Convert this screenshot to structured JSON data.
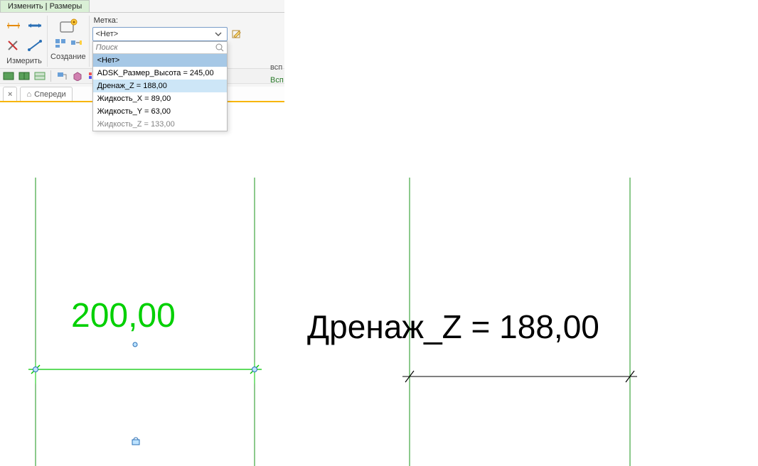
{
  "ribbon": {
    "tab": "Изменить | Размеры",
    "group_measure": "Измерить",
    "group_create": "Создание",
    "label_panel_title": "Метка:",
    "dropdown_value": "<Нет>",
    "search_placeholder": "Поиск",
    "items": [
      "<Нет>",
      "ADSK_Размер_Высота = 245,00",
      "Дренаж_Z = 188,00",
      "Жидкость_X = 89,00",
      "Жидкость_Y = 63,00",
      "Жидкость_Z = 133,00"
    ],
    "right_text_1": "всп",
    "right_text_2": "Всп"
  },
  "view_tabs": {
    "active_close": "×",
    "home_icon": "⌂",
    "front": "Спереди"
  },
  "canvas": {
    "dim1_value": "200,00",
    "dim2_value": "Дренаж_Z = 188,00"
  }
}
